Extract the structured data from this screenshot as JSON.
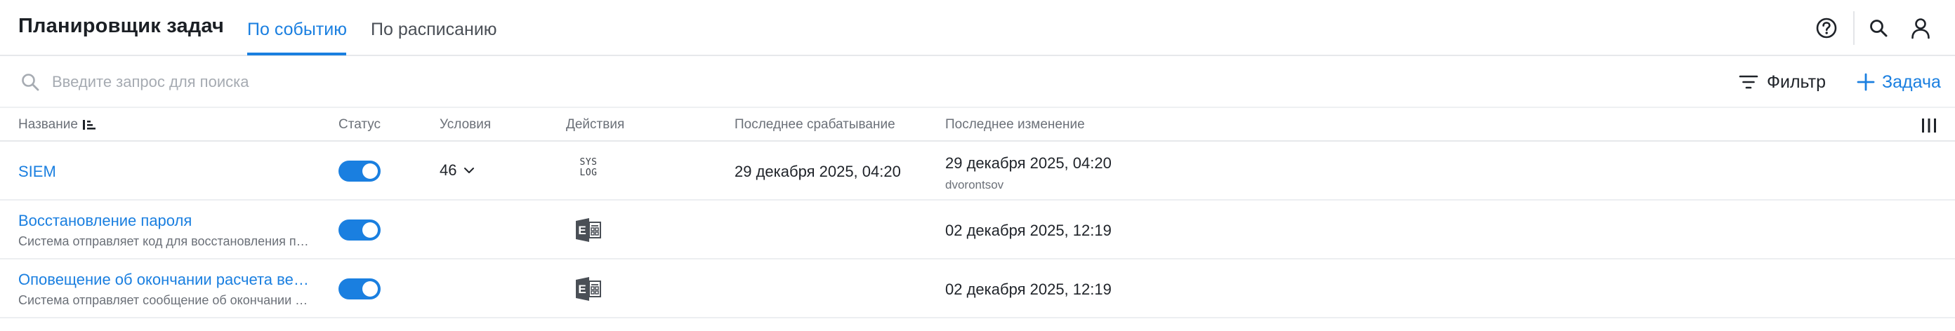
{
  "header": {
    "title": "Планировщик задач",
    "tabs": [
      {
        "label": "По событию",
        "active": true
      },
      {
        "label": "По расписанию",
        "active": false
      }
    ],
    "icons": [
      "help-icon",
      "search-icon",
      "user-icon"
    ]
  },
  "toolbar": {
    "search_placeholder": "Введите запрос для поиска",
    "filter_label": "Фильтр",
    "add_label": "Задача"
  },
  "table": {
    "columns": [
      "Название",
      "Статус",
      "Условия",
      "Действия",
      "Последнее срабатывание",
      "Последнее изменение"
    ],
    "rows": [
      {
        "name": "SIEM",
        "description": "",
        "status_on": true,
        "conditions": "46",
        "action": "SYS LOG",
        "action_icon": "syslog-icon",
        "last_triggered": "29 декабря 2025, 04:20",
        "last_modified": "29 декабря 2025, 04:20",
        "modified_by": "dvorontsov"
      },
      {
        "name": "Восстановление пароля",
        "description": "Система отправляет код для восстановления пароля",
        "status_on": true,
        "conditions": "",
        "action": "",
        "action_icon": "exchange-icon",
        "last_triggered": "",
        "last_modified": "02 декабря 2025, 12:19",
        "modified_by": ""
      },
      {
        "name": "Оповещение об окончании расчета вектора",
        "description": "Система отправляет сообщение об окончании расчета",
        "status_on": true,
        "conditions": "",
        "action": "",
        "action_icon": "exchange-icon",
        "last_triggered": "",
        "last_modified": "02 декабря 2025, 12:19",
        "modified_by": ""
      }
    ]
  },
  "colors": {
    "accent": "#1a7fe0",
    "text": "#1f2329",
    "muted": "#6b7078",
    "border": "#e6e8eb"
  }
}
